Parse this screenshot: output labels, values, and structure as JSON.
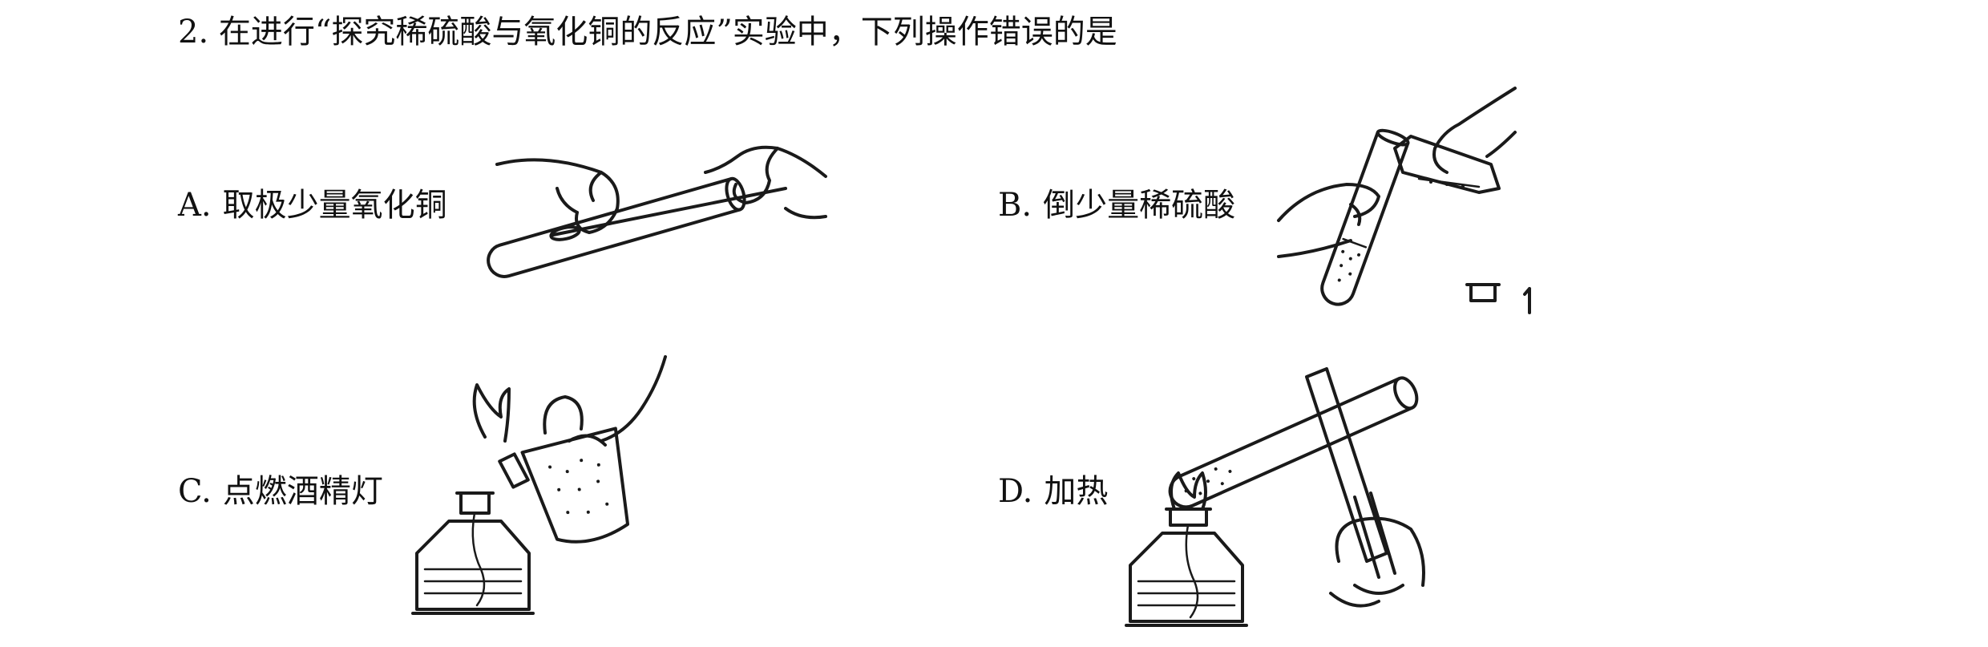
{
  "question": {
    "number": "2.",
    "text": "在进行“探究稀硫酸与氧化铜的反应”实验中，下列操作错误的是"
  },
  "options": [
    {
      "letter": "A.",
      "text": "取极少量氧化铜"
    },
    {
      "letter": "B.",
      "text": "倒少量稀硫酸"
    },
    {
      "letter": "C.",
      "text": "点燃酒精灯"
    },
    {
      "letter": "D.",
      "text": "加热"
    }
  ]
}
